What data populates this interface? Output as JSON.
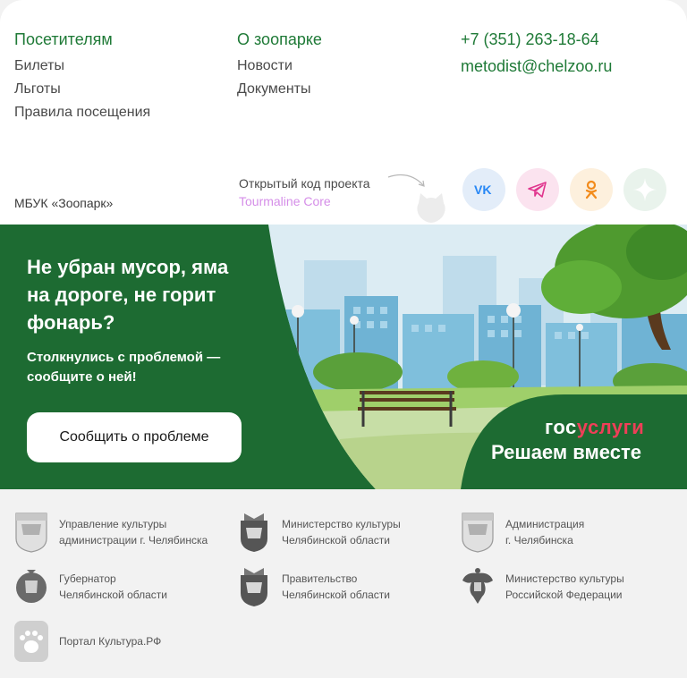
{
  "visitors": {
    "heading": "Посетителям",
    "links": [
      "Билеты",
      "Льготы",
      "Правила посещения"
    ]
  },
  "about": {
    "heading": "О зоопарке",
    "links": [
      "Новости",
      "Документы"
    ]
  },
  "contacts": {
    "phone": "+7 (351) 263-18-64",
    "email": "metodist@chelzoo.ru"
  },
  "org_name": "МБУК «Зоопарк»",
  "open_source": {
    "label": "Открытый код проекта",
    "link": "Tourmaline Core"
  },
  "social": [
    {
      "icon": "vk-icon",
      "color": "#2787f5"
    },
    {
      "icon": "telegram-icon",
      "color": "#e0348d"
    },
    {
      "icon": "odnoklassniki-icon",
      "color": "#f28b1b"
    },
    {
      "icon": "zen-icon",
      "color": "#8ac6a3"
    }
  ],
  "banner": {
    "title": "Не убран мусор, яма на дороге, не горит фонарь?",
    "subtitle": "Столкнулись с проблемой — сообщите о ней!",
    "button": "Сообщить о проблеме",
    "brand_gos": "гос",
    "brand_uslugi": "услуги",
    "slogan": "Решаем вместе"
  },
  "partners": [
    {
      "line1": "Управление культуры",
      "line2": "администрации г. Челябинска"
    },
    {
      "line1": "Министерство культуры",
      "line2": "Челябинской области"
    },
    {
      "line1": "Администрация",
      "line2": "г. Челябинска"
    },
    {
      "line1": "Губернатор",
      "line2": "Челябинской области"
    },
    {
      "line1": "Правительство",
      "line2": "Челябинской области"
    },
    {
      "line1": "Министерство культуры",
      "line2": "Российской Федерации"
    },
    {
      "line1": "Портал Культура.РФ",
      "line2": ""
    }
  ]
}
